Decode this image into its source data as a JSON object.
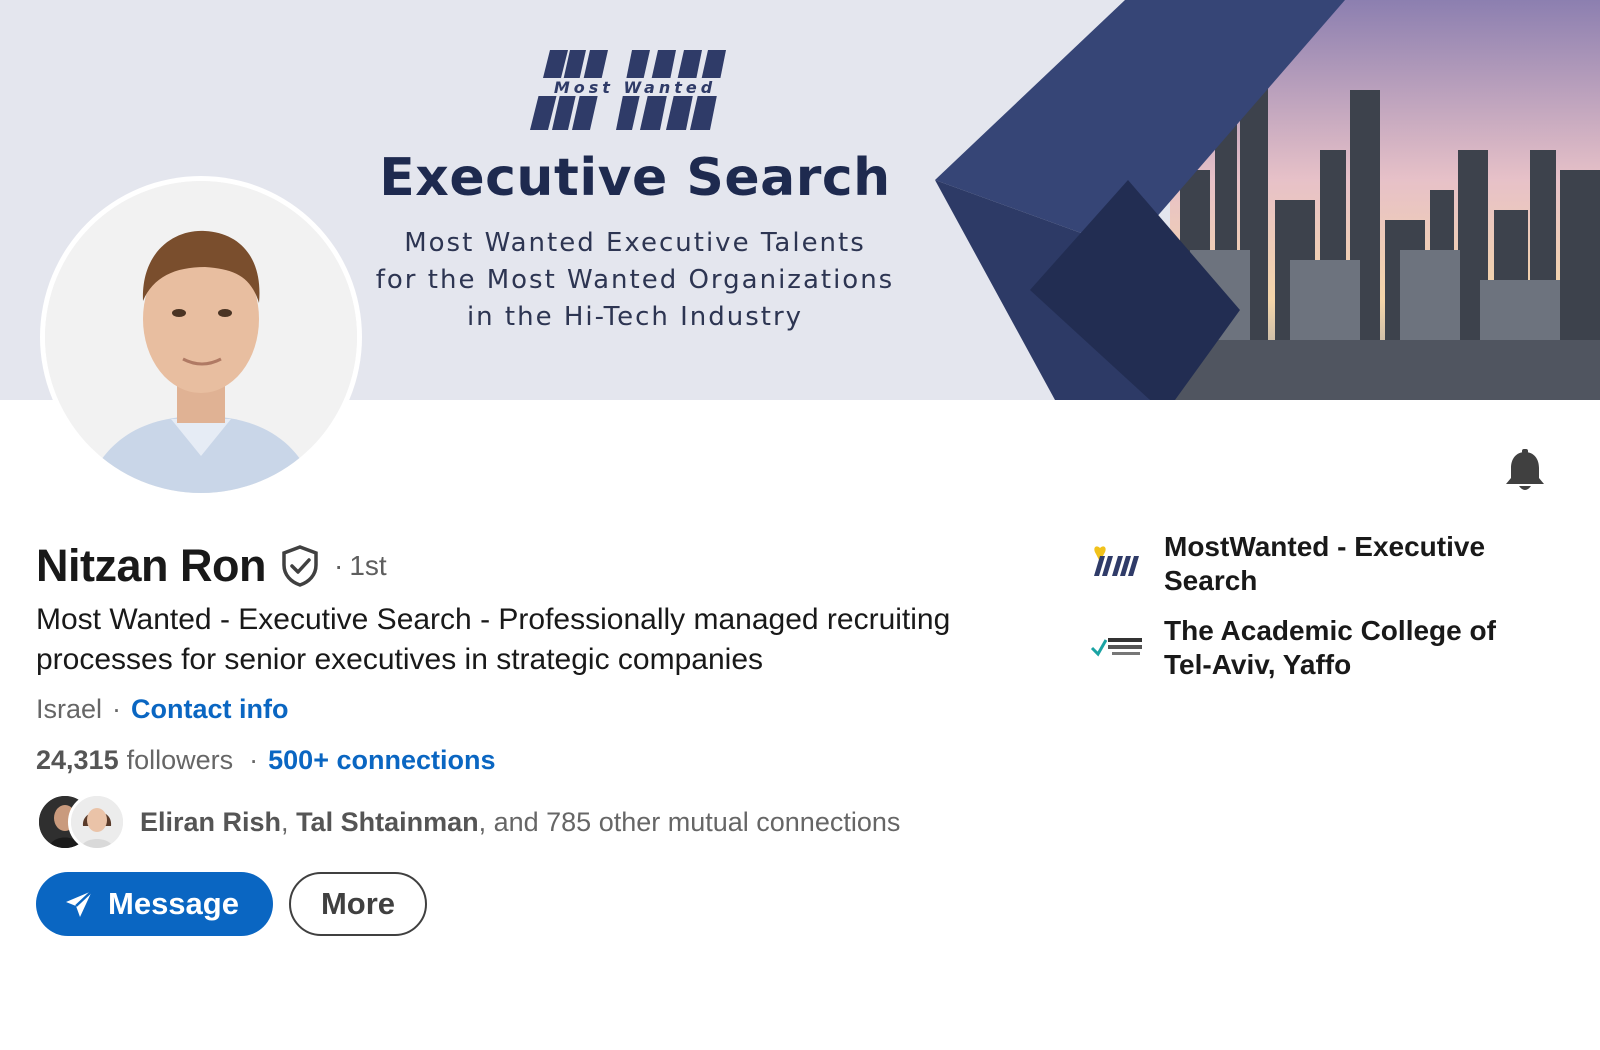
{
  "banner": {
    "logo_tag": "Most Wanted",
    "title": "Executive Search",
    "subtitle_lines": [
      "Most Wanted Executive Talents",
      "for the Most Wanted Organizations",
      "in the Hi-Tech Industry"
    ],
    "colors": {
      "navy": "#2f3b68",
      "dark_navy": "#1e2a4f",
      "background": "#e4e6ee"
    }
  },
  "profile": {
    "name": "Nitzan Ron",
    "degree": "1st",
    "headline": "Most Wanted - Executive Search - Professionally managed recruiting processes for senior executives in strategic companies",
    "location": "Israel",
    "contact_info_label": "Contact info",
    "followers_count": "24,315",
    "followers_label": "followers",
    "connections_label": "500+ connections",
    "mutual": {
      "name1": "Eliran Rish",
      "name2": "Tal Shtainman",
      "rest": ", and 785 other mutual connections"
    }
  },
  "actions": {
    "message_label": "Message",
    "more_label": "More"
  },
  "organizations": [
    {
      "name": "MostWanted - Executive Search",
      "icon": "mostwanted-logo"
    },
    {
      "name": "The Academic College of Tel-Aviv, Yaffo",
      "icon": "college-logo"
    }
  ],
  "colors": {
    "link": "#0a66c2",
    "primary_button": "#0a66c2",
    "text": "#191919",
    "muted": "#666666"
  }
}
